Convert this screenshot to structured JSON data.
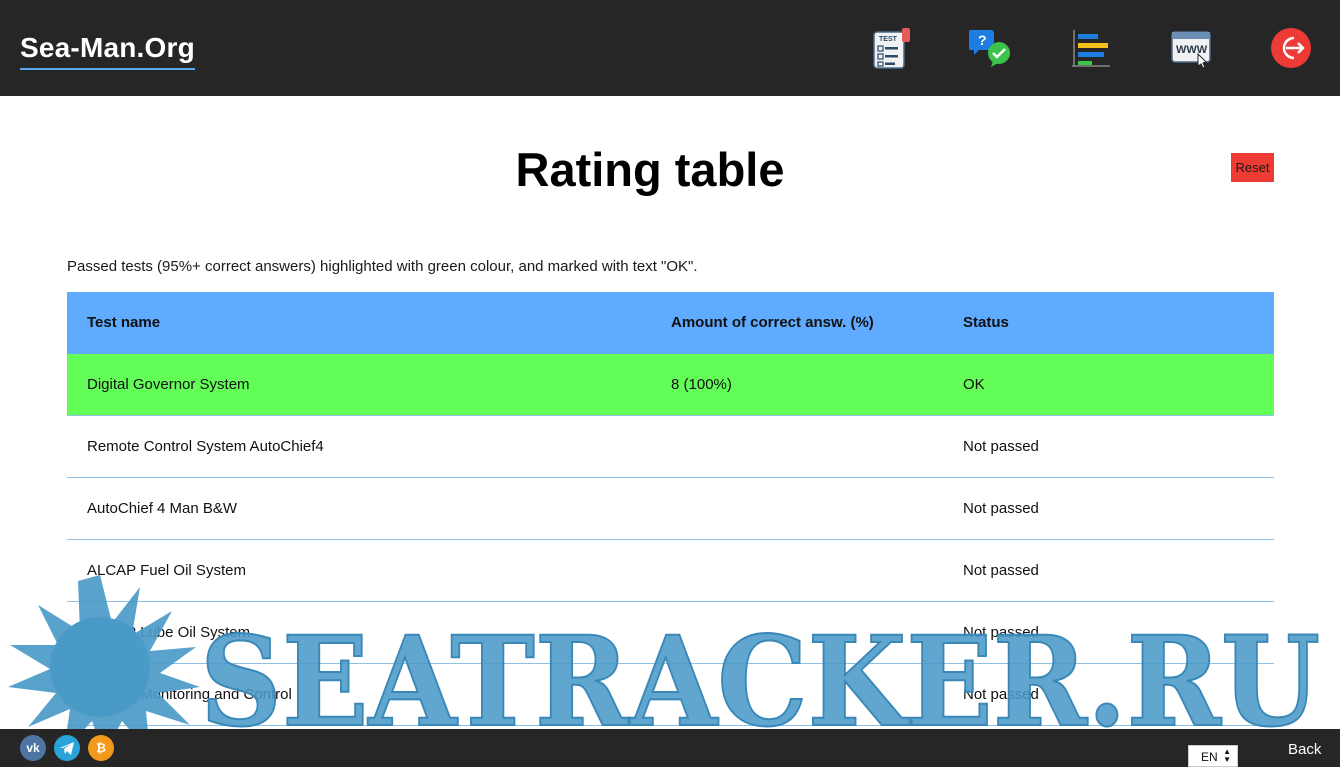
{
  "header": {
    "logo": "Sea-Man.Org",
    "nav_icons": [
      "test-icon",
      "questions-icon",
      "rating-icon",
      "www-icon",
      "logout-icon"
    ],
    "test_icon_label": "TEST",
    "www_icon_label": "WWW"
  },
  "page": {
    "title": "Rating table",
    "reset_label": "Reset",
    "note": "Passed tests (95%+ correct answers) highlighted with green colour, and marked with text \"OK\"."
  },
  "table": {
    "headers": [
      "Test name",
      "Amount of correct answ. (%)",
      "Status"
    ],
    "rows": [
      {
        "name": "Digital Governor System",
        "amount": "8 (100%)",
        "status": "OK",
        "passed": true
      },
      {
        "name": "Remote Control System AutoChief4",
        "amount": "",
        "status": "Not passed",
        "passed": false
      },
      {
        "name": "AutoChief 4 Man B&W",
        "amount": "",
        "status": "Not passed",
        "passed": false
      },
      {
        "name": "ALCAP Fuel Oil System",
        "amount": "",
        "status": "Not passed",
        "passed": false
      },
      {
        "name": "ALCAP Lube Oil System",
        "amount": "",
        "status": "Not passed",
        "passed": false
      },
      {
        "name": "ALCAP Monitoring and Control",
        "amount": "",
        "status": "Not passed",
        "passed": false
      }
    ]
  },
  "watermark": {
    "text": "SEATRACKER.RU"
  },
  "footer": {
    "social": [
      "vk-icon",
      "telegram-icon",
      "bitcoin-icon"
    ],
    "language": "EN",
    "back_label": "Back"
  },
  "colors": {
    "header_bg": "#262626",
    "table_header_bg": "#5fabff",
    "passed_row_bg": "#62fe57",
    "reset_bg": "#ee3b33",
    "watermark": "#4a9ac8"
  }
}
